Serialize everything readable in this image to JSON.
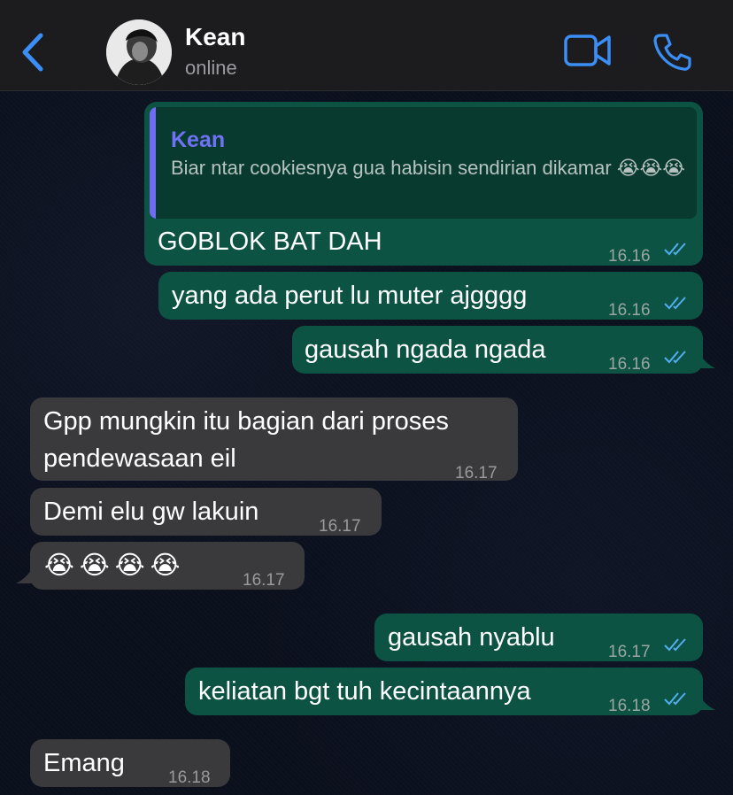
{
  "header": {
    "contact_name": "Kean",
    "status": "online"
  },
  "colors": {
    "accent": "#3a8ef6",
    "outgoing_bubble": "#0d5344",
    "incoming_bubble": "#3a3a3c",
    "quote_bar": "#6f6cf2",
    "ticks": "#53aef0"
  },
  "messages": [
    {
      "direction": "out",
      "reply_to": {
        "name": "Kean",
        "text": "Biar ntar cookiesnya gua habisin sendirian dikamar 😭😭😭"
      },
      "text": "GOBLOK BAT DAH",
      "time": "16.16",
      "read": true
    },
    {
      "direction": "out",
      "text": "yang ada perut lu muter ajgggg",
      "time": "16.16",
      "read": true
    },
    {
      "direction": "out",
      "text": "gausah ngada ngada",
      "time": "16.16",
      "read": true
    },
    {
      "direction": "in",
      "text_lines": [
        "Gpp mungkin itu bagian dari proses",
        "pendewasaan eil"
      ],
      "time": "16.17"
    },
    {
      "direction": "in",
      "text": "Demi elu gw lakuin",
      "time": "16.17"
    },
    {
      "direction": "in",
      "text": "😭😭😭😭",
      "time": "16.17"
    },
    {
      "direction": "out",
      "text": "gausah nyablu",
      "time": "16.17",
      "read": true
    },
    {
      "direction": "out",
      "text": "keliatan bgt tuh kecintaannya",
      "time": "16.18",
      "read": true
    },
    {
      "direction": "in",
      "text": "Emang",
      "time": "16.18"
    }
  ]
}
